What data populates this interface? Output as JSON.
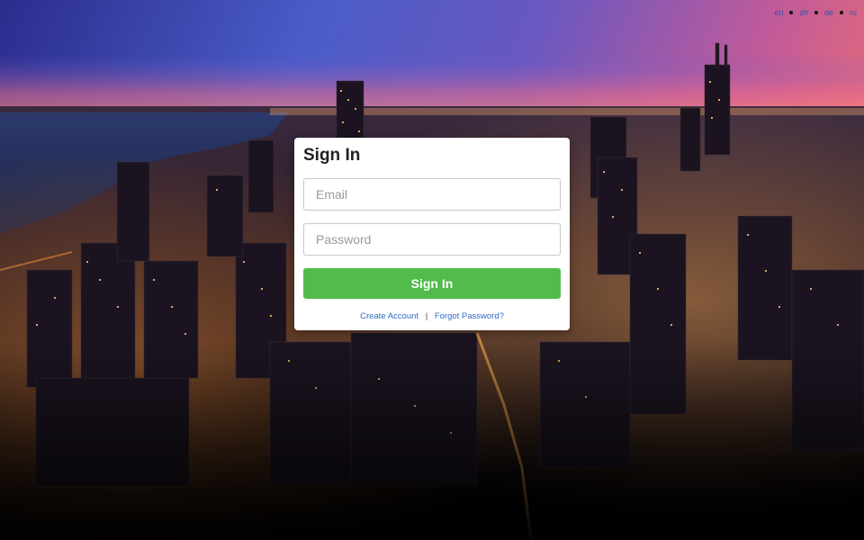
{
  "languages": [
    "en",
    "zh",
    "de",
    "ru"
  ],
  "signin": {
    "title": "Sign In",
    "email_placeholder": "Email",
    "password_placeholder": "Password",
    "submit_label": "Sign In",
    "create_account_label": "Create Account",
    "separator": "|",
    "forgot_password_label": "Forgot Password?"
  },
  "colors": {
    "primary_button": "#52bb4b",
    "link": "#2f6bc8"
  },
  "background": {
    "description_icon": "city-night-skyline-image"
  }
}
